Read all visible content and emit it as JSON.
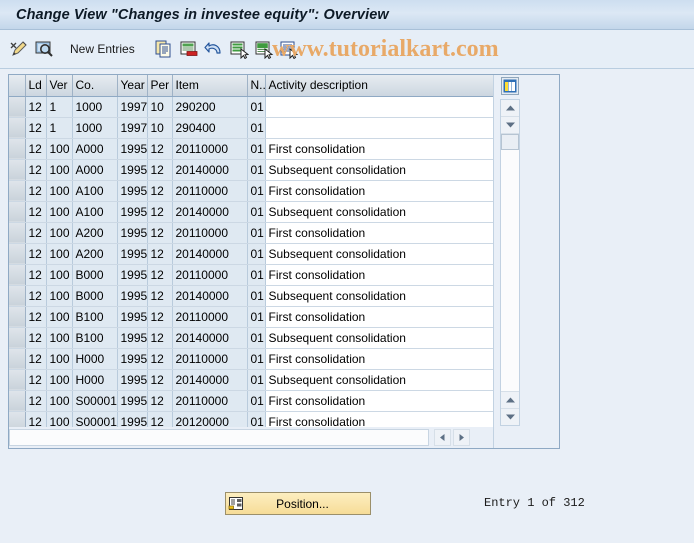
{
  "window": {
    "title": "Change View \"Changes in investee equity\": Overview"
  },
  "toolbar": {
    "items": [
      {
        "name": "display-change-icon",
        "label": ""
      },
      {
        "name": "check-entries-icon",
        "label": ""
      },
      {
        "name": "new-entries-button",
        "label": "New Entries"
      },
      {
        "name": "copy-icon",
        "label": ""
      },
      {
        "name": "delete-icon",
        "label": ""
      },
      {
        "name": "undo-icon",
        "label": ""
      },
      {
        "name": "select-all-icon",
        "label": ""
      },
      {
        "name": "select-block-icon",
        "label": ""
      },
      {
        "name": "deselect-all-icon",
        "label": ""
      }
    ],
    "new_entries_label": "New Entries"
  },
  "watermark": {
    "text": "www.tutorialkart.com",
    "color": "#e8a968"
  },
  "table": {
    "columns": [
      {
        "key": "ld",
        "label": "Ld"
      },
      {
        "key": "ver",
        "label": "Ver"
      },
      {
        "key": "co",
        "label": "Co."
      },
      {
        "key": "year",
        "label": "Year"
      },
      {
        "key": "per",
        "label": "Per"
      },
      {
        "key": "item",
        "label": "Item"
      },
      {
        "key": "n",
        "label": "N.."
      },
      {
        "key": "desc",
        "label": "Activity description"
      }
    ],
    "rows": [
      {
        "ld": "12",
        "ver": "1",
        "co": "1000",
        "year": "1997",
        "per": "10",
        "item": "290200",
        "n": "01",
        "desc": ""
      },
      {
        "ld": "12",
        "ver": "1",
        "co": "1000",
        "year": "1997",
        "per": "10",
        "item": "290400",
        "n": "01",
        "desc": ""
      },
      {
        "ld": "12",
        "ver": "100",
        "co": "A000",
        "year": "1995",
        "per": "12",
        "item": "20110000",
        "n": "01",
        "desc": "First consolidation"
      },
      {
        "ld": "12",
        "ver": "100",
        "co": "A000",
        "year": "1995",
        "per": "12",
        "item": "20140000",
        "n": "01",
        "desc": "Subsequent consolidation"
      },
      {
        "ld": "12",
        "ver": "100",
        "co": "A100",
        "year": "1995",
        "per": "12",
        "item": "20110000",
        "n": "01",
        "desc": "First consolidation"
      },
      {
        "ld": "12",
        "ver": "100",
        "co": "A100",
        "year": "1995",
        "per": "12",
        "item": "20140000",
        "n": "01",
        "desc": "Subsequent consolidation"
      },
      {
        "ld": "12",
        "ver": "100",
        "co": "A200",
        "year": "1995",
        "per": "12",
        "item": "20110000",
        "n": "01",
        "desc": "First consolidation"
      },
      {
        "ld": "12",
        "ver": "100",
        "co": "A200",
        "year": "1995",
        "per": "12",
        "item": "20140000",
        "n": "01",
        "desc": "Subsequent consolidation"
      },
      {
        "ld": "12",
        "ver": "100",
        "co": "B000",
        "year": "1995",
        "per": "12",
        "item": "20110000",
        "n": "01",
        "desc": "First consolidation"
      },
      {
        "ld": "12",
        "ver": "100",
        "co": "B000",
        "year": "1995",
        "per": "12",
        "item": "20140000",
        "n": "01",
        "desc": "Subsequent consolidation"
      },
      {
        "ld": "12",
        "ver": "100",
        "co": "B100",
        "year": "1995",
        "per": "12",
        "item": "20110000",
        "n": "01",
        "desc": "First consolidation"
      },
      {
        "ld": "12",
        "ver": "100",
        "co": "B100",
        "year": "1995",
        "per": "12",
        "item": "20140000",
        "n": "01",
        "desc": "Subsequent consolidation"
      },
      {
        "ld": "12",
        "ver": "100",
        "co": "H000",
        "year": "1995",
        "per": "12",
        "item": "20110000",
        "n": "01",
        "desc": "First consolidation"
      },
      {
        "ld": "12",
        "ver": "100",
        "co": "H000",
        "year": "1995",
        "per": "12",
        "item": "20140000",
        "n": "01",
        "desc": "Subsequent consolidation"
      },
      {
        "ld": "12",
        "ver": "100",
        "co": "S00001",
        "year": "1995",
        "per": "12",
        "item": "20110000",
        "n": "01",
        "desc": "First consolidation"
      },
      {
        "ld": "12",
        "ver": "100",
        "co": "S00001",
        "year": "1995",
        "per": "12",
        "item": "20120000",
        "n": "01",
        "desc": "First consolidation"
      }
    ]
  },
  "scrollbars": {
    "config_icon": "table-settings-icon",
    "up_icon": "scroll-up-icon",
    "down_icon": "scroll-down-icon",
    "left_icon": "scroll-left-icon",
    "right_icon": "scroll-right-icon"
  },
  "footer": {
    "position_label": "Position...",
    "position_icon": "position-icon",
    "entry_status": "Entry 1 of 312"
  }
}
